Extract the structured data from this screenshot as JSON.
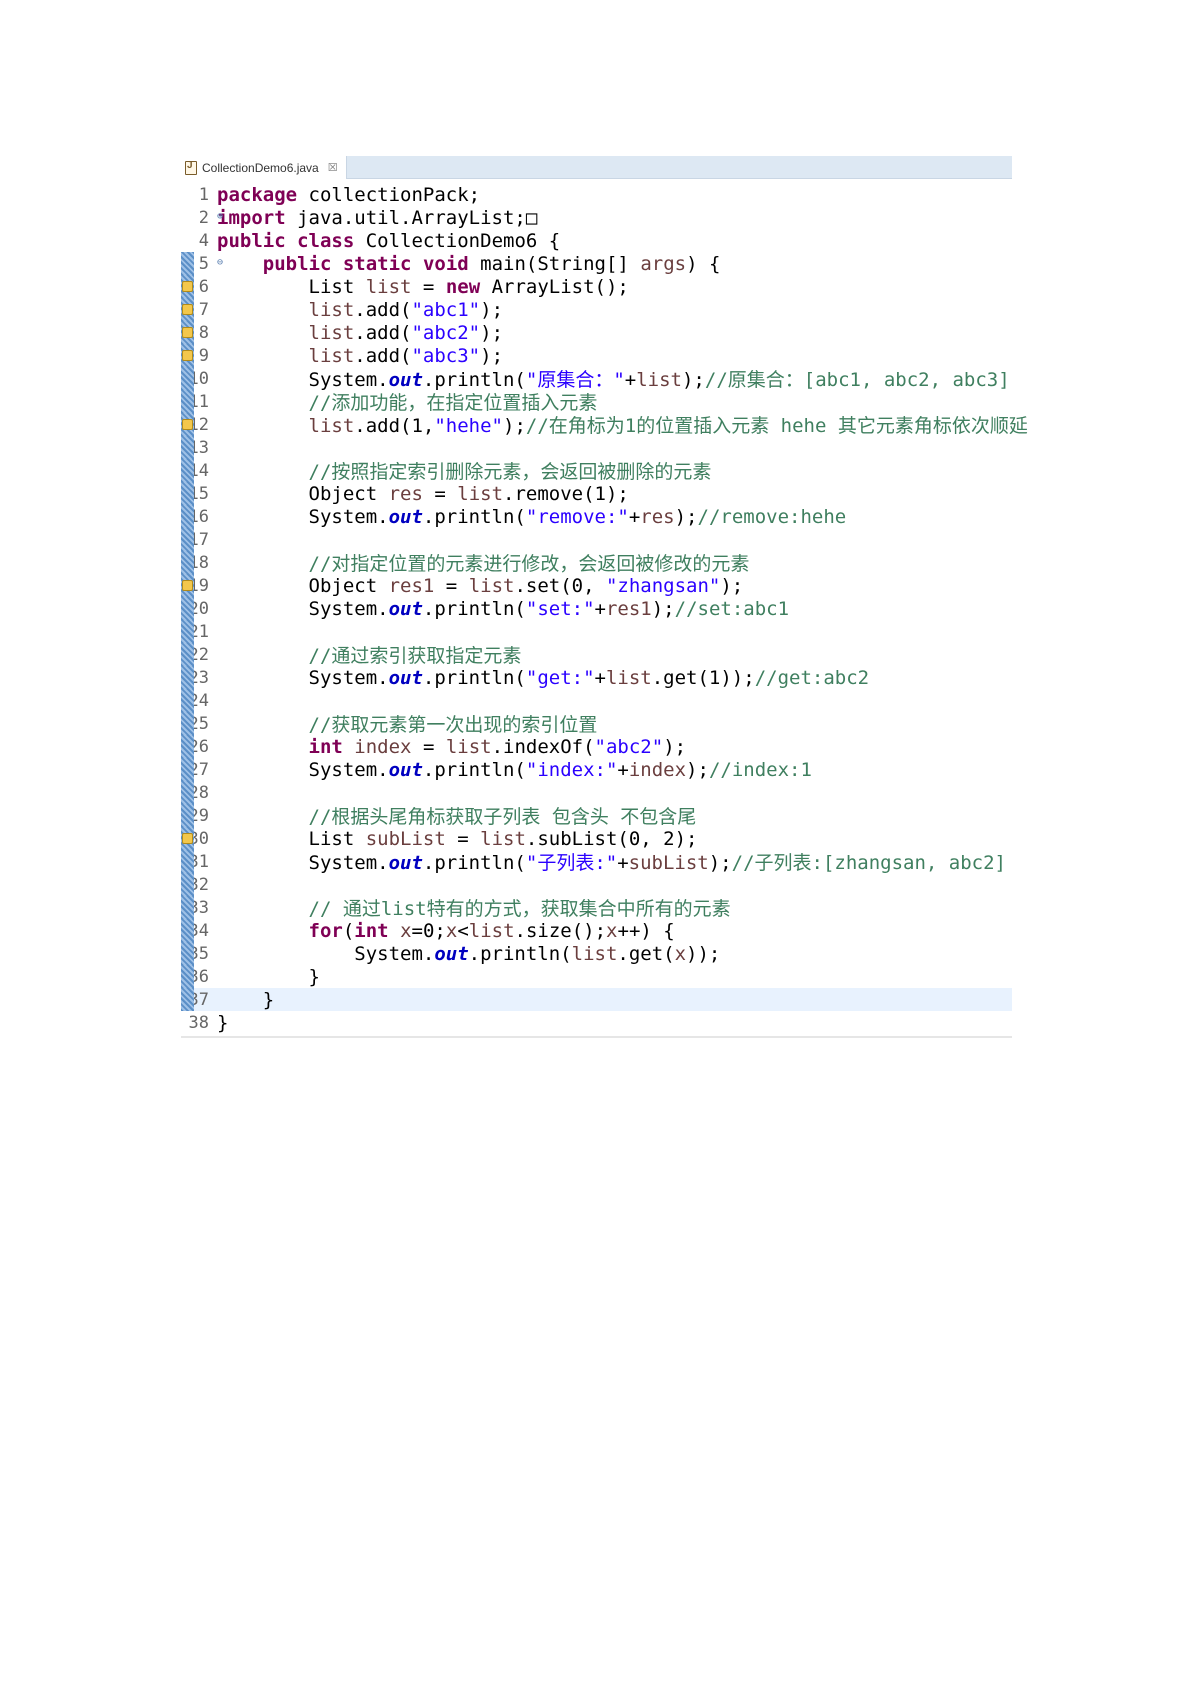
{
  "tab": {
    "filename": "CollectionDemo6.java",
    "close_glyph": "☒"
  },
  "lines": [
    {
      "n": "1",
      "code": "package collectionPack;"
    },
    {
      "n": "2",
      "code": "import java.util.ArrayList;□",
      "fold": "⊕"
    },
    {
      "n": "4",
      "code": "public class CollectionDemo6 {"
    },
    {
      "n": "5",
      "code": "    public static void main(String[] args) {",
      "fold": "⊖",
      "bar": true
    },
    {
      "n": "6",
      "code": "        List list = new ArrayList();",
      "marker": true,
      "bar": true
    },
    {
      "n": "7",
      "code": "        list.add(\"abc1\");",
      "marker": true,
      "bar": true
    },
    {
      "n": "8",
      "code": "        list.add(\"abc2\");",
      "marker": true,
      "bar": true
    },
    {
      "n": "9",
      "code": "        list.add(\"abc3\");",
      "marker": true,
      "bar": true
    },
    {
      "n": "10",
      "code": "        System.out.println(\"原集合：\"+list);//原集合：[abc1, abc2, abc3]",
      "bar": true
    },
    {
      "n": "11",
      "code": "        //添加功能，在指定位置插入元素",
      "bar": true
    },
    {
      "n": "12",
      "code": "        list.add(1,\"hehe\");//在角标为1的位置插入元素 hehe 其它元素角标依次顺延",
      "marker": true,
      "bar": true
    },
    {
      "n": "13",
      "code": "",
      "bar": true
    },
    {
      "n": "14",
      "code": "        //按照指定索引删除元素，会返回被删除的元素",
      "bar": true
    },
    {
      "n": "15",
      "code": "        Object res = list.remove(1);",
      "bar": true
    },
    {
      "n": "16",
      "code": "        System.out.println(\"remove:\"+res);//remove:hehe",
      "bar": true
    },
    {
      "n": "17",
      "code": "",
      "bar": true
    },
    {
      "n": "18",
      "code": "        //对指定位置的元素进行修改，会返回被修改的元素",
      "bar": true
    },
    {
      "n": "19",
      "code": "        Object res1 = list.set(0, \"zhangsan\");",
      "marker": true,
      "bar": true
    },
    {
      "n": "20",
      "code": "        System.out.println(\"set:\"+res1);//set:abc1",
      "bar": true
    },
    {
      "n": "21",
      "code": "",
      "bar": true
    },
    {
      "n": "22",
      "code": "        //通过索引获取指定元素",
      "bar": true
    },
    {
      "n": "23",
      "code": "        System.out.println(\"get:\"+list.get(1));//get:abc2",
      "bar": true
    },
    {
      "n": "24",
      "code": "",
      "bar": true
    },
    {
      "n": "25",
      "code": "        //获取元素第一次出现的索引位置",
      "bar": true
    },
    {
      "n": "26",
      "code": "        int index = list.indexOf(\"abc2\");",
      "bar": true
    },
    {
      "n": "27",
      "code": "        System.out.println(\"index:\"+index);//index:1",
      "bar": true
    },
    {
      "n": "28",
      "code": "",
      "bar": true
    },
    {
      "n": "29",
      "code": "        //根据头尾角标获取子列表 包含头 不包含尾",
      "bar": true
    },
    {
      "n": "30",
      "code": "        List subList = list.subList(0, 2);",
      "marker": true,
      "bar": true
    },
    {
      "n": "31",
      "code": "        System.out.println(\"子列表:\"+subList);//子列表:[zhangsan, abc2]",
      "bar": true
    },
    {
      "n": "32",
      "code": "",
      "bar": true
    },
    {
      "n": "33",
      "code": "        // 通过list特有的方式，获取集合中所有的元素",
      "bar": true
    },
    {
      "n": "34",
      "code": "        for(int x=0;x<list.size();x++) {",
      "bar": true
    },
    {
      "n": "35",
      "code": "            System.out.println(list.get(x));",
      "bar": true
    },
    {
      "n": "36",
      "code": "        }",
      "bar": true
    },
    {
      "n": "37",
      "code": "    }",
      "bar": true,
      "highlight": true
    },
    {
      "n": "38",
      "code": "}"
    }
  ],
  "colors": {
    "keyword": "#7f0055",
    "string": "#2a00ff",
    "comment": "#3f7f5f",
    "field": "#0000c0",
    "local": "#6a3e3e"
  }
}
